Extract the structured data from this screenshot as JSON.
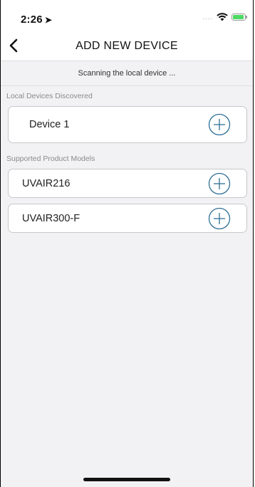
{
  "status_bar": {
    "time": "2:26",
    "location_arrow": "➤",
    "signal": "....",
    "icons": [
      "wifi-icon",
      "battery-icon"
    ],
    "battery_color": "#4cd964"
  },
  "nav": {
    "title": "ADD NEW DEVICE",
    "back_icon": "chevron-left-icon"
  },
  "scanning_text": "Scanning the local device ...",
  "sections": {
    "local": {
      "header": "Local Devices Discovered",
      "items": [
        {
          "label": "Device 1",
          "icon": "plus-circle-icon"
        }
      ]
    },
    "supported": {
      "header": "Supported Product Models",
      "items": [
        {
          "label": "UVAIR216",
          "icon": "plus-circle-icon"
        },
        {
          "label": "UVAIR300-F",
          "icon": "plus-circle-icon"
        }
      ]
    }
  },
  "colors": {
    "accent": "#2f6f97",
    "background": "#f2f2f4",
    "card_border": "#c8c8cc"
  }
}
